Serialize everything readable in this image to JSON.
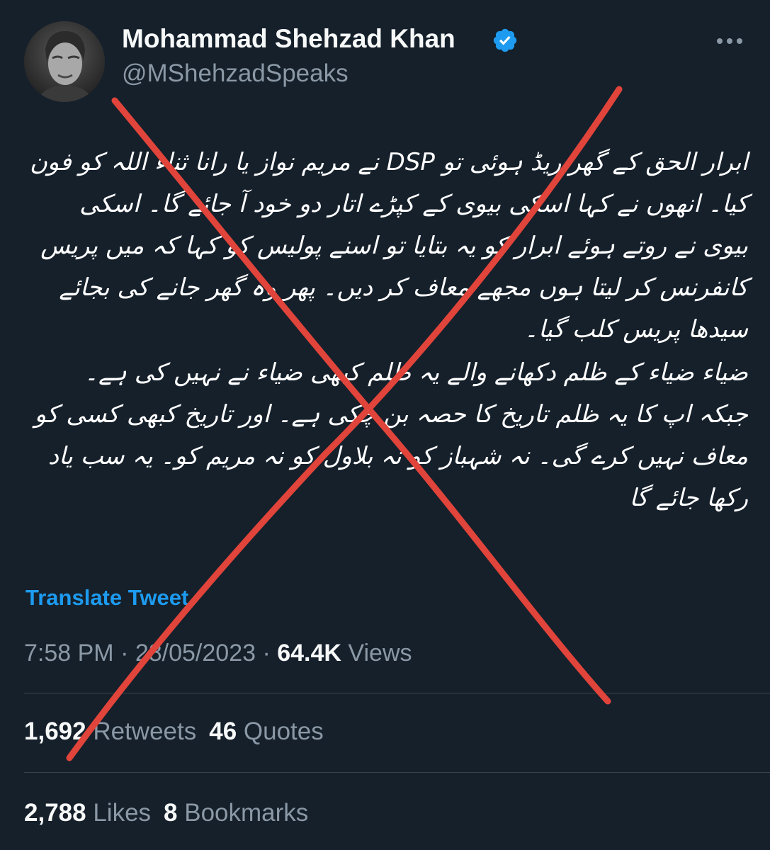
{
  "author": {
    "name": "Mohammad Shehzad Khan",
    "handle": "@MShehzadSpeaks",
    "verified_icon": "verified-badge-icon",
    "avatar_icon": "profile-photo"
  },
  "more_icon": "more-options-icon",
  "tweet": {
    "paragraphs": [
      "ابرار الحق کے گھر ریڈ ہوئی تو DSP نے مریم نواز یا رانا ثناء اللہ کو فون کیا۔ انھوں نے کہا اسکی بیوی کے کپڑے اتار دو خود آ جائے گا۔ اسکی بیوی نے روتے ہوئے ابرار کو یہ بتایا تو اسنے پولیس کو کہا کہ میں پریس کانفرنس کر لیتا ہوں مجھے معاف کر دیں۔ پھر وہ گھر جانے کی بجائے سیدھا پریس کلب گیا۔",
      "ضیاء ضیاء کے ظلم دکھانے والے یہ ظلم کبھی ضیاء نے نہیں کی ہے۔ جبکہ اپ کا یہ ظلم تاریخ کا حصہ بن چکی ہے۔ اور تاریخ کبھی کسی کو معاف نہیں کرے گی۔ نہ شہباز کو نہ بلاول کو نہ مریم کو۔ یہ سب یاد رکھا جائے گا"
    ],
    "translate_label": "Translate Tweet"
  },
  "meta": {
    "time": "7:58 PM",
    "sep1": " · ",
    "date": "28/05/2023",
    "sep2": " · ",
    "views_count": "64.4K",
    "views_label": "Views"
  },
  "stats": {
    "retweets_count": "1,692",
    "retweets_label": "Retweets",
    "quotes_count": "46",
    "quotes_label": "Quotes",
    "likes_count": "2,788",
    "likes_label": "Likes",
    "bookmarks_count": "8",
    "bookmarks_label": "Bookmarks"
  },
  "colors": {
    "background": "#15202b",
    "accent": "#1d9bf0",
    "cross": "#e0443a",
    "muted": "#8b98a5"
  }
}
